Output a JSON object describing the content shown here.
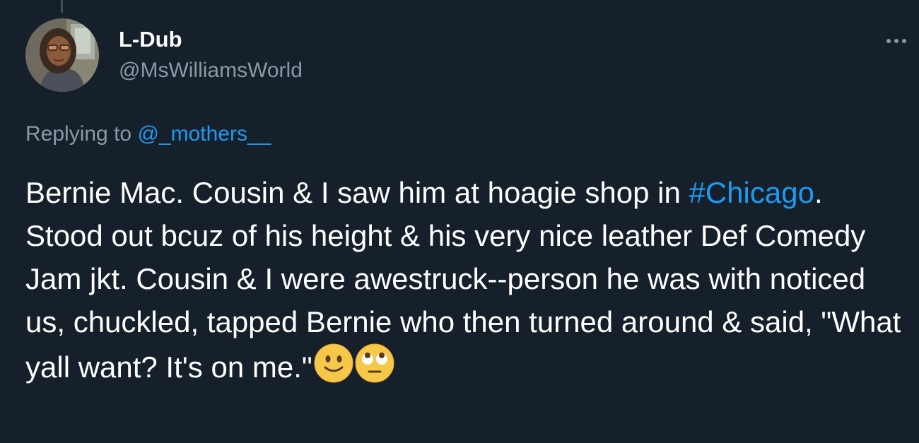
{
  "tweet": {
    "display_name": "L-Dub",
    "handle": "@MsWilliamsWorld",
    "replying_to_label": "Replying to",
    "replying_to_user": "@_mothers__",
    "text_part1": "Bernie Mac. Cousin & I saw him at hoagie shop in ",
    "hashtag": "#Chicago",
    "text_part2": ". Stood out bcuz of his height & his very nice leather Def Comedy Jam jkt. Cousin & I were awestruck--person he was with noticed us, chuckled, tapped Bernie who then turned around & said, \"What yall want? It's on me.\"",
    "emojis": [
      "slightly-smiling-face-emoji",
      "face-with-rolling-eyes-emoji"
    ]
  },
  "icons": {
    "more": "more-horizontal-icon",
    "avatar": "profile-photo"
  },
  "colors": {
    "background": "#16202b",
    "link": "#1d9bf0",
    "secondary_text": "#8b98a5",
    "primary_text": "#ffffff"
  }
}
